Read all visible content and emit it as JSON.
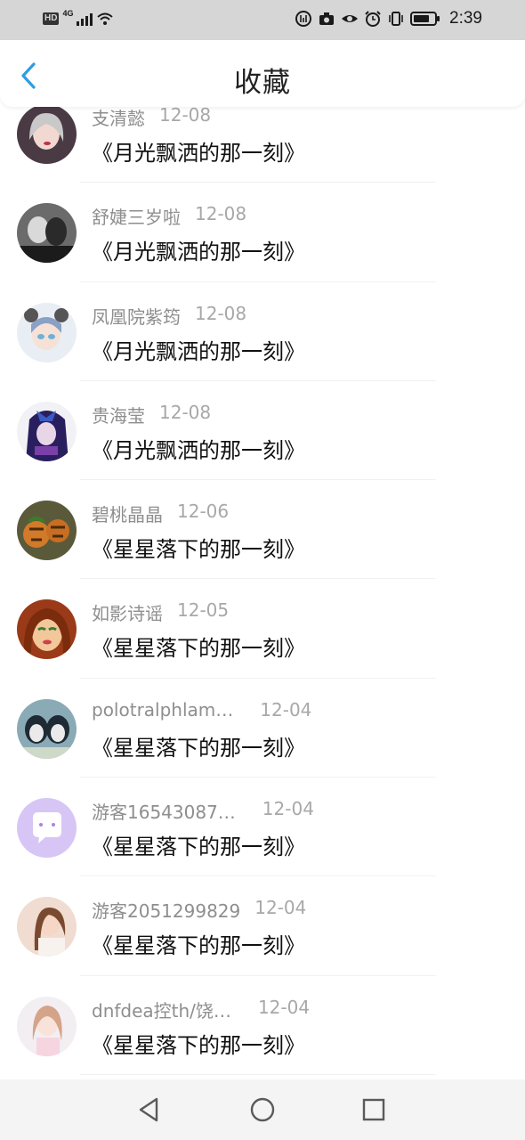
{
  "status_bar": {
    "left_badge": "HD",
    "network": "4G",
    "time": "2:39"
  },
  "header": {
    "title": "收藏",
    "accent_color": "#2f9de3"
  },
  "favorites": [
    {
      "user": "支清懿",
      "date": "12-08",
      "work": "《月光飘洒的那一刻》"
    },
    {
      "user": "舒婕三岁啦",
      "date": "12-08",
      "work": "《月光飘洒的那一刻》"
    },
    {
      "user": "凤凰院紫筠",
      "date": "12-08",
      "work": "《月光飘洒的那一刻》"
    },
    {
      "user": "贵海莹",
      "date": "12-08",
      "work": "《月光飘洒的那一刻》"
    },
    {
      "user": "碧桃晶晶",
      "date": "12-06",
      "work": "《星星落下的那一刻》"
    },
    {
      "user": "如影诗谣",
      "date": "12-05",
      "work": "《星星落下的那一刻》"
    },
    {
      "user": "polotralphlam…",
      "date": "12-04",
      "work": "《星星落下的那一刻》"
    },
    {
      "user": "游客16543087…",
      "date": "12-04",
      "work": "《星星落下的那一刻》"
    },
    {
      "user": "游客2051299829",
      "date": "12-04",
      "work": "《星星落下的那一刻》"
    },
    {
      "user": "dnfdea控th/饶…",
      "date": "12-04",
      "work": "《星星落下的那一刻》"
    }
  ],
  "nav_icons": [
    "back-triangle-icon",
    "home-circle-icon",
    "recents-square-icon"
  ]
}
